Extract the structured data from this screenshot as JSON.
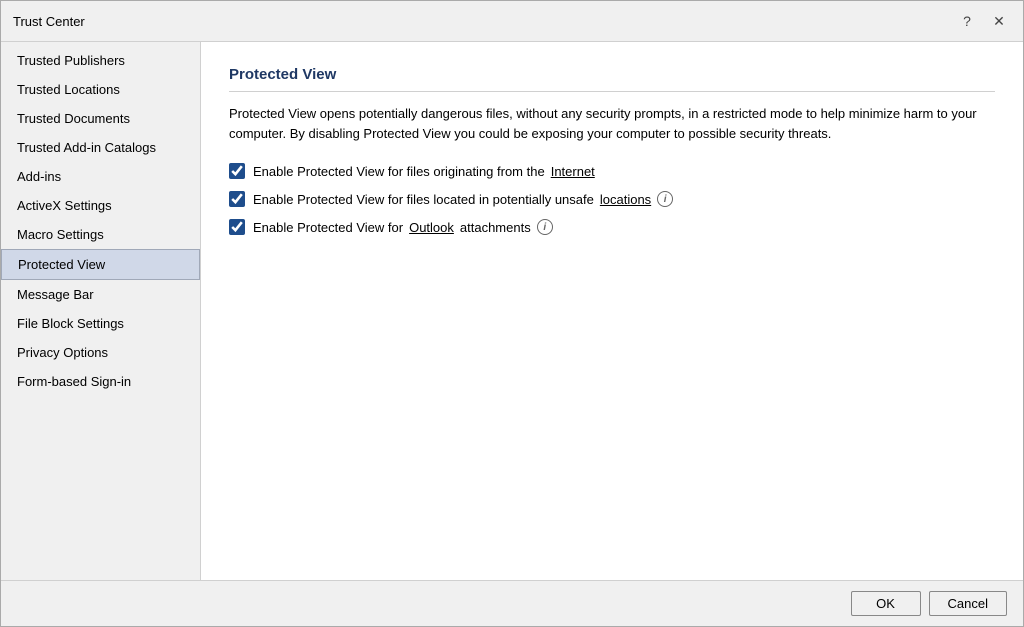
{
  "window": {
    "title": "Trust Center",
    "help_icon": "?",
    "close_icon": "✕"
  },
  "sidebar": {
    "items": [
      {
        "id": "trusted-publishers",
        "label": "Trusted Publishers",
        "active": false
      },
      {
        "id": "trusted-locations",
        "label": "Trusted Locations",
        "active": false
      },
      {
        "id": "trusted-documents",
        "label": "Trusted Documents",
        "active": false
      },
      {
        "id": "trusted-add-in-catalogs",
        "label": "Trusted Add-in Catalogs",
        "active": false
      },
      {
        "id": "add-ins",
        "label": "Add-ins",
        "active": false
      },
      {
        "id": "activex-settings",
        "label": "ActiveX Settings",
        "active": false
      },
      {
        "id": "macro-settings",
        "label": "Macro Settings",
        "active": false
      },
      {
        "id": "protected-view",
        "label": "Protected View",
        "active": true
      },
      {
        "id": "message-bar",
        "label": "Message Bar",
        "active": false
      },
      {
        "id": "file-block-settings",
        "label": "File Block Settings",
        "active": false
      },
      {
        "id": "privacy-options",
        "label": "Privacy Options",
        "active": false
      },
      {
        "id": "form-based-sign-in",
        "label": "Form-based Sign-in",
        "active": false
      }
    ]
  },
  "main": {
    "section_title": "Protected View",
    "description": "Protected View opens potentially dangerous files, without any security prompts, in a restricted mode to help minimize harm to your computer. By disabling Protected View you could be exposing your computer to possible security threats.",
    "checkboxes": [
      {
        "id": "cb-internet",
        "checked": true,
        "label_before": "Enable Protected View for files originating from the ",
        "underline_word": "Internet",
        "label_after": "",
        "has_info": false
      },
      {
        "id": "cb-unsafe-locations",
        "checked": true,
        "label_before": "Enable Protected View for files located in potentially unsafe ",
        "underline_word": "locations",
        "label_after": "",
        "has_info": true
      },
      {
        "id": "cb-outlook",
        "checked": true,
        "label_before": "Enable Protected View for ",
        "underline_word": "Outlook",
        "label_after": " attachments",
        "has_info": true
      }
    ]
  },
  "footer": {
    "ok_label": "OK",
    "cancel_label": "Cancel"
  }
}
